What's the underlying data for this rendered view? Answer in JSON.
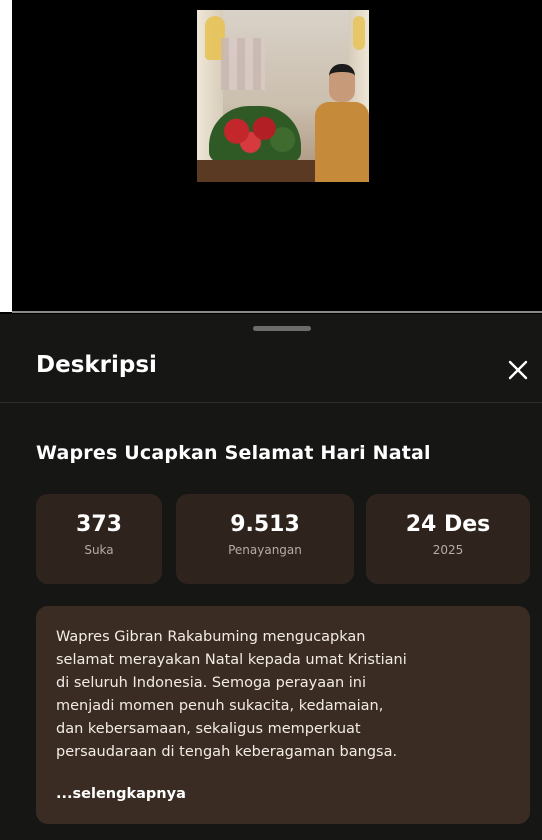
{
  "sheet": {
    "title": "Deskripsi",
    "close_icon": "close-icon"
  },
  "video": {
    "title": "Wapres Ucapkan Selamat Hari Natal",
    "stats": {
      "likes": {
        "value": "373",
        "label": "Suka"
      },
      "views": {
        "value": "9.513",
        "label": "Penayangan"
      },
      "date": {
        "value": "24 Des",
        "label": "2025"
      }
    },
    "description": "Wapres Gibran Rakabuming mengucapkan\nselamat merayakan Natal kepada umat Kristiani\ndi seluruh Indonesia. Semoga perayaan ini\nmenjadi momen penuh sukacita, kedamaian,\ndan kebersamaan, sekaligus memperkuat\npersaudaraan di tengah keberagaman bangsa.",
    "more_label": "...selengkapnya"
  },
  "colors": {
    "background": "#000000",
    "sheet": "#161615",
    "stat_card": "#2f241d",
    "description_box": "#3a2c22",
    "muted_text": "#b7aca3"
  }
}
